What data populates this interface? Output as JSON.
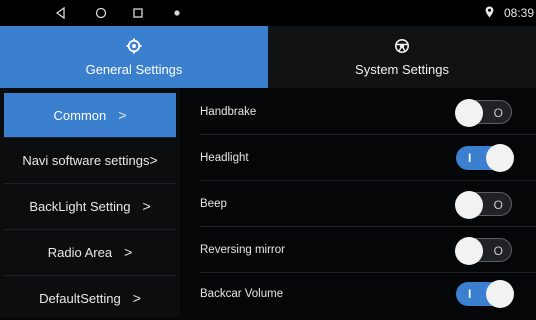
{
  "statusbar": {
    "nav_icons": [
      "back-icon",
      "home-icon",
      "recents-icon",
      "notification-dot-icon"
    ],
    "location_icon": "location-pin-icon",
    "time": "08:39"
  },
  "tabs": [
    {
      "label": "General Settings",
      "icon": "gear-icon",
      "active": true
    },
    {
      "label": "System Settings",
      "icon": "car-wheel-icon",
      "active": false
    }
  ],
  "menu": {
    "items": [
      {
        "label": "Common",
        "chevron": ">",
        "active": true
      },
      {
        "label": "Navi software settings",
        "chevron": ">",
        "active": false
      },
      {
        "label": "BackLight Setting",
        "chevron": ">",
        "active": false
      },
      {
        "label": "Radio Area",
        "chevron": ">",
        "active": false
      },
      {
        "label": "DefaultSetting",
        "chevron": ">",
        "active": false
      }
    ]
  },
  "settings": {
    "rows": [
      {
        "label": "Handbrake",
        "state": "off",
        "mark": "O"
      },
      {
        "label": "Headlight",
        "state": "on",
        "mark": "I"
      },
      {
        "label": "Beep",
        "state": "off",
        "mark": "O"
      },
      {
        "label": "Reversing mirror",
        "state": "off",
        "mark": "O"
      },
      {
        "label": "Backcar Volume",
        "state": "on",
        "mark": "I"
      }
    ]
  },
  "colors": {
    "accent": "#3b7fcf",
    "background": "#050607",
    "toggle_off": "#202326"
  }
}
